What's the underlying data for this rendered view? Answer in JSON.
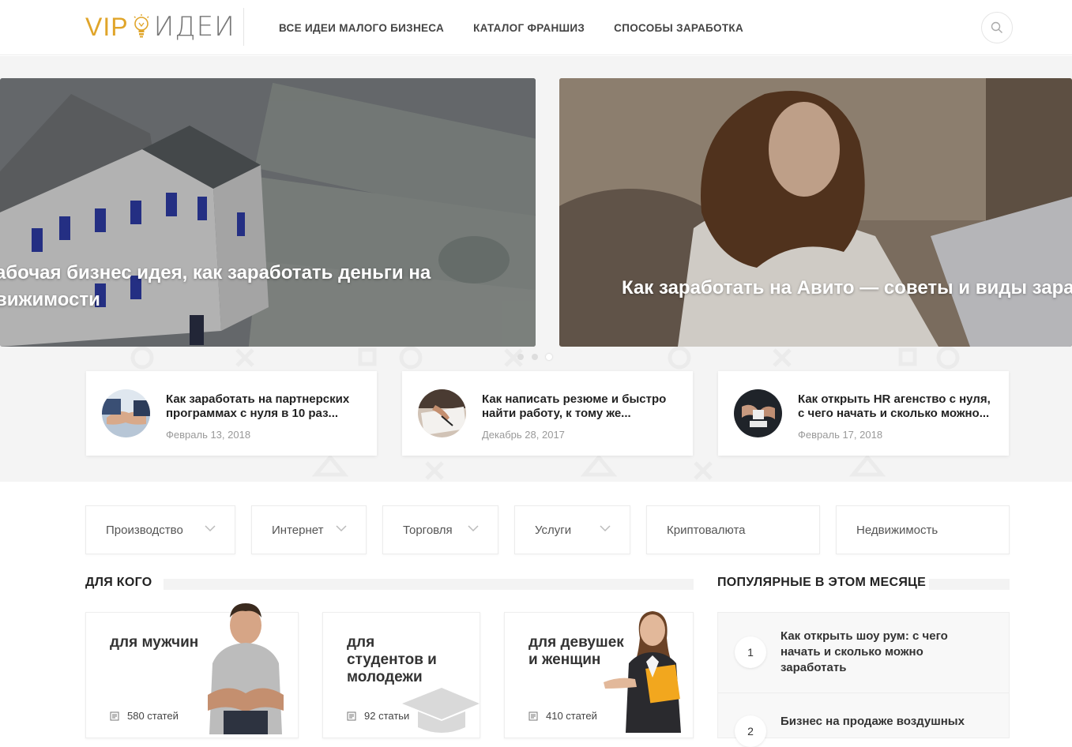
{
  "header": {
    "logo_vip": "VIP",
    "logo_idei": "ИДЕИ",
    "nav": [
      {
        "label": "ВСЕ ИДЕИ МАЛОГО БИЗНЕСА"
      },
      {
        "label": "КАТАЛОГ ФРАНШИЗ"
      },
      {
        "label": "СПОСОБЫ ЗАРАБОТКА"
      }
    ],
    "search_icon": "search-icon"
  },
  "slider": {
    "slides": [
      {
        "title_line1": "абочая бизнес идея, как заработать деньги на",
        "title_line2": "вижимости"
      },
      {
        "title_line1": "Как заработать на Авито — советы и виды зарабо"
      }
    ],
    "active_dot": 3
  },
  "featured": [
    {
      "title": "Как заработать на партнерских программах с нуля в 10 раз...",
      "date": "Февраль 13, 2018"
    },
    {
      "title": "Как написать резюме и быстро найти работу, к тому же...",
      "date": "Декабрь 28, 2017"
    },
    {
      "title": "Как открыть HR агенство с нуля, с чего начать и сколько можно...",
      "date": "Февраль 17, 2018"
    }
  ],
  "categories": [
    {
      "label": "Производство",
      "has_dropdown": true
    },
    {
      "label": "Интернет",
      "has_dropdown": true
    },
    {
      "label": "Торговля",
      "has_dropdown": true
    },
    {
      "label": "Услуги",
      "has_dropdown": true
    },
    {
      "label": "Криптовалюта",
      "has_dropdown": false
    },
    {
      "label": "Недвижимость",
      "has_dropdown": false
    }
  ],
  "audience": {
    "title": "ДЛЯ КОГО",
    "cards": [
      {
        "title": "для мужчин",
        "count": "580 статей"
      },
      {
        "title_line1": "для",
        "title_line2": "студентов и",
        "title_line3": "молодежи",
        "count": "92 статьи"
      },
      {
        "title_line1": "для девушек",
        "title_line2": "и женщин",
        "count": "410 статей"
      }
    ]
  },
  "popular": {
    "title": "ПОПУЛЯРНЫЕ В ЭТОМ МЕСЯЦЕ",
    "items": [
      {
        "num": "1",
        "text": "Как открыть шоу рум: с чего начать и сколько можно заработать"
      },
      {
        "num": "2",
        "text": "Бизнес на продаже воздушных"
      }
    ]
  },
  "colors": {
    "accent": "#e0a52a",
    "background": "#f4f4f4"
  }
}
